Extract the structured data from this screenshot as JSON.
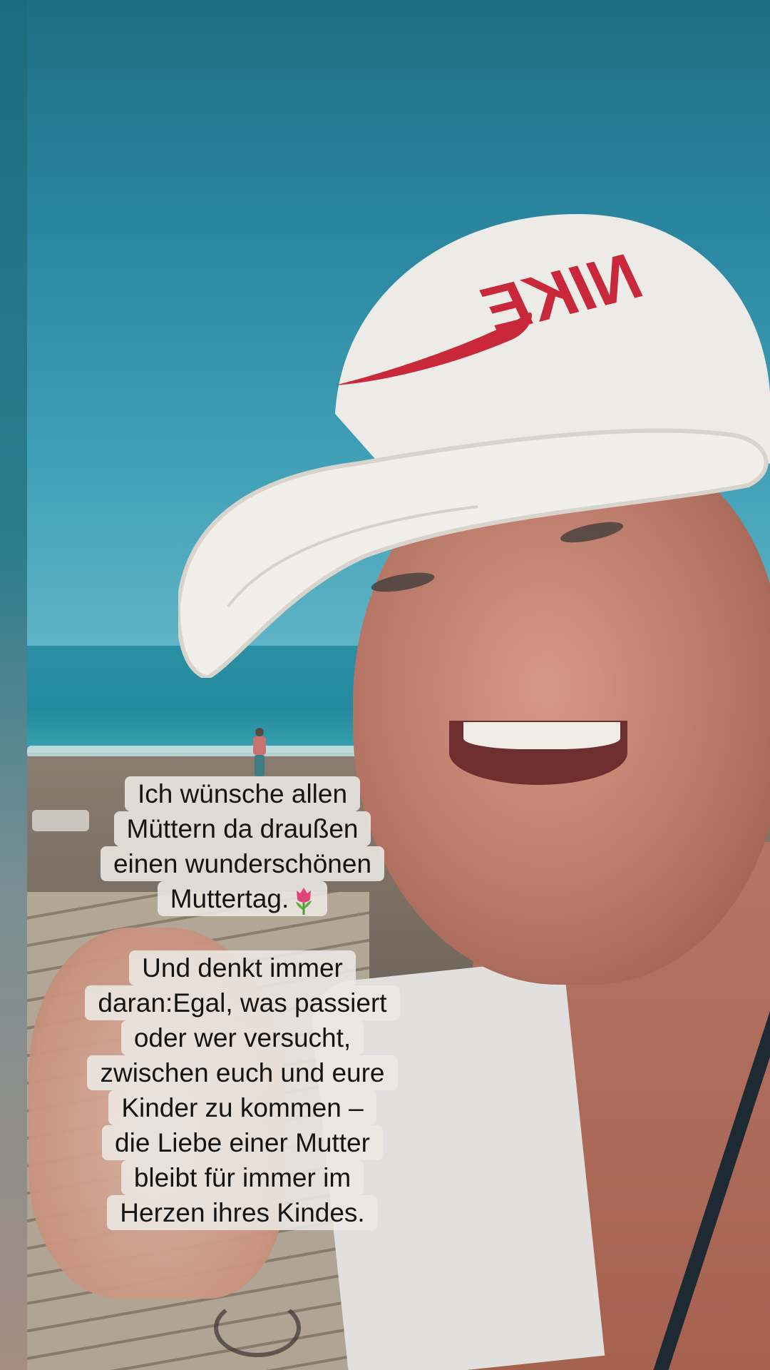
{
  "caption_first": {
    "lines": [
      "Ich wünsche allen",
      "Müttern da draußen",
      "einen wunderschönen",
      "Muttertag."
    ],
    "emoji": "tulip-emoji"
  },
  "caption_second": {
    "lines": [
      "Und denkt immer",
      "daran:Egal, was passiert",
      "oder wer versucht,",
      "zwischen euch und eure",
      "Kinder zu kommen –",
      "die Liebe einer Mutter",
      "bleibt für immer im",
      "Herzen ihres Kindes."
    ]
  },
  "cap_logo_text": "NIKE",
  "colors": {
    "sky": "#2a86a0",
    "sea": "#238a9d",
    "caption_bg": "#ece8e4",
    "cap_logo": "#c8283a",
    "cap_white": "#ecebe7"
  }
}
